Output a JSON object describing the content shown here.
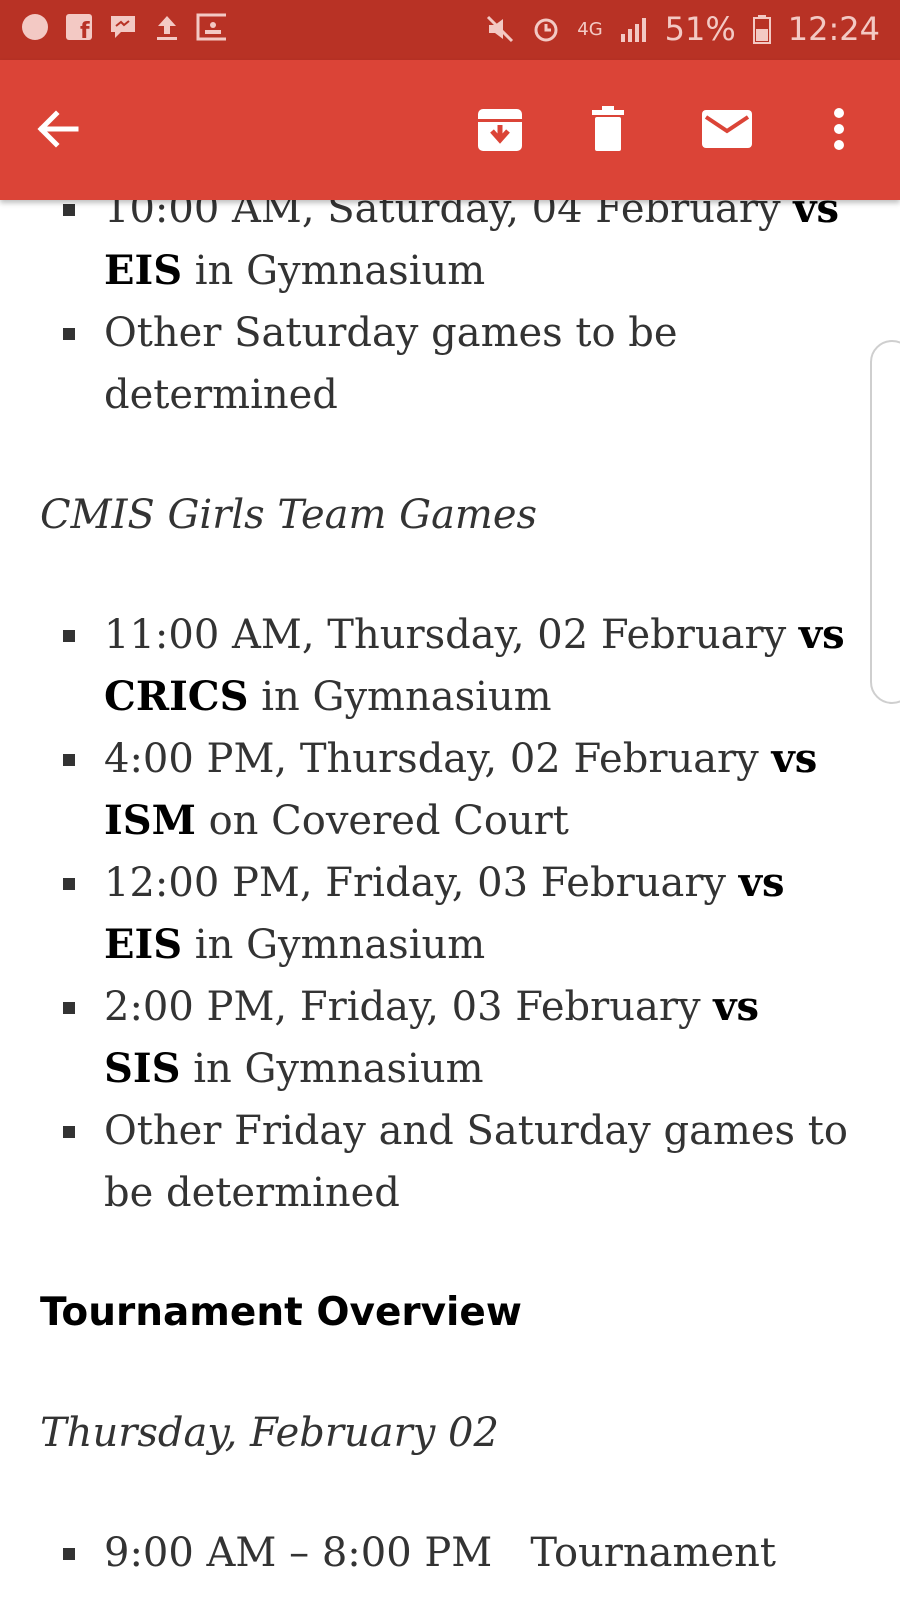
{
  "status_bar": {
    "network": "4G",
    "battery": "51%",
    "time": "12:24",
    "left_icons": [
      "circle-icon",
      "facebook-icon",
      "messenger-icon",
      "upload-icon",
      "classroom-icon"
    ],
    "right_icons": [
      "mute-icon",
      "alarm-icon",
      "signal-icon",
      "battery-icon"
    ]
  },
  "toolbar": {
    "back_icon": "back-arrow-icon",
    "archive_icon": "archive-icon",
    "delete_icon": "delete-icon",
    "mark_unread_icon": "mail-icon",
    "more_icon": "more-vert-icon"
  },
  "email": {
    "boys_items": [
      {
        "pre": "10:00 AM, Saturday, 04 February ",
        "bold1": "vs",
        "bold2": "EIS",
        "post": " in Gymnasium"
      },
      {
        "text": "Other Saturday games to be determined"
      }
    ],
    "girls_heading": "CMIS Girls Team Games",
    "girls_items": [
      {
        "pre": "11:00 AM, Thursday, 02 February ",
        "bold1": "vs",
        "bold2": "CRICS",
        "post": " in Gymnasium"
      },
      {
        "pre": "4:00 PM, Thursday, 02 February ",
        "bold1": "vs",
        "bold2": "ISM",
        "post": " on Covered Court"
      },
      {
        "pre": "12:00 PM, Friday, 03 February ",
        "bold1": "vs",
        "bold2": "EIS",
        "post": " in Gymnasium"
      },
      {
        "pre": "2:00 PM, Friday, 03 February ",
        "bold1": "vs",
        "bold2": "SIS",
        "post": " in Gymnasium"
      },
      {
        "text": "Other Friday and Saturday games to be determined"
      }
    ],
    "overview_heading": "Tournament Overview",
    "day_heading": "Thursday, February 02",
    "day_items": [
      {
        "text": "9:00 AM – 8:00 PM   Tournament"
      }
    ]
  },
  "colors": {
    "status_bar": "#b83225",
    "app_bar": "#db4437",
    "text": "#333333"
  }
}
